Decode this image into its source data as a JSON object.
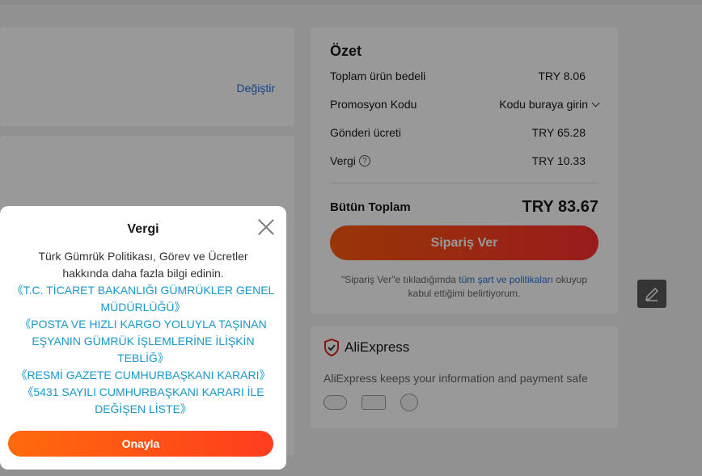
{
  "address": {
    "change_label": "Değiştir"
  },
  "summary": {
    "title": "Özet",
    "subtotal_label": "Toplam ürün bedeli",
    "subtotal_value": "TRY 8.06",
    "promo_label": "Promosyon Kodu",
    "promo_value": "Kodu buraya girin",
    "shipping_label": "Gönderi ücreti",
    "shipping_value": "TRY 65.28",
    "tax_label": "Vergi",
    "tax_value": "TRY 10.33",
    "total_label": "Bütün Toplam",
    "total_value": "TRY 83.67",
    "order_button": "Sipariş Ver",
    "terms_prefix": "\"Sipariş Ver\"e tıkladığımda",
    "terms_link": "tüm şart ve politikaları",
    "terms_suffix": "okuyup kabul ettiğimi belirtiyorum."
  },
  "trust": {
    "brand": "AliExpress",
    "safe_text": "AliExpress keeps your information and payment safe"
  },
  "modal": {
    "title": "Vergi",
    "intro": "Türk Gümrük Politikası, Görev ve Ücretler hakkında daha fazla bilgi edinin.",
    "links": [
      "《T.C. TİCARET BAKANLIĞI GÜMRÜKLER GENEL MÜDÜRLÜĞÜ》",
      "《POSTA VE HIZLI KARGO YOLUYLA TAŞINAN EŞYANIN GÜMRÜK İŞLEMLERİNE İLİŞKİN TEBLİĞ》",
      "《RESMİ GAZETE CUMHURBAŞKANI KARARI》",
      "《5431 SAYILI CUMHURBAŞKANI KARARI İLE DEĞİŞEN LİSTE》"
    ],
    "confirm_button": "Onayla"
  },
  "colors": {
    "accent": "#ff4f14",
    "link": "#2e6fd6",
    "modal_link": "#1a98c9"
  }
}
